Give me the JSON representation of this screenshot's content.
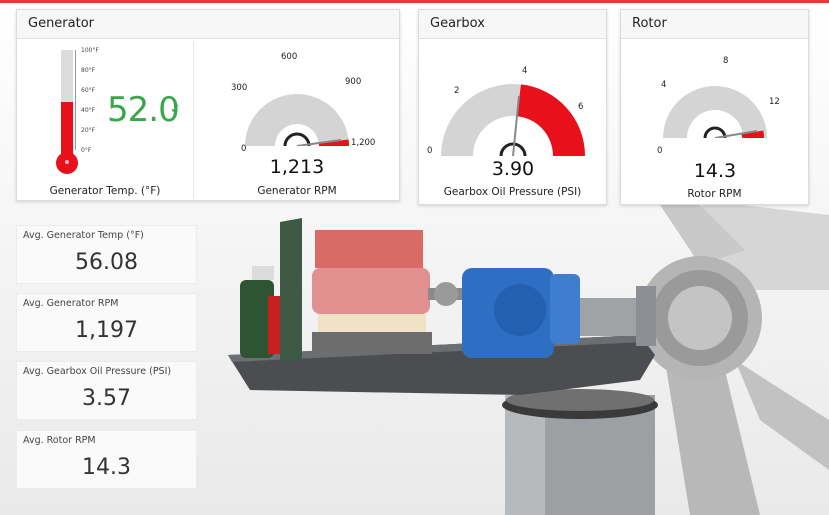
{
  "generator": {
    "title": "Generator",
    "temp_value": "52.0",
    "temp_caption": "Generator Temp.  (°F)",
    "temp_ticks": [
      "100°F",
      "80°F",
      "60°F",
      "40°F",
      "20°F",
      "0°F"
    ],
    "temp_level": 0.52,
    "rpm_value": "1,213",
    "rpm_caption": "Generator RPM",
    "rpm_ticks": [
      "0",
      "300",
      "600",
      "900",
      "1,200"
    ]
  },
  "gearbox": {
    "title": "Gearbox",
    "value": "3.90",
    "caption": "Gearbox Oil Pressure (PSI)",
    "ticks": [
      "0",
      "2",
      "4",
      "6"
    ]
  },
  "rotor": {
    "title": "Rotor",
    "value": "14.3",
    "caption": "Rotor RPM",
    "ticks": [
      "0",
      "4",
      "8",
      "12"
    ]
  },
  "stats": [
    {
      "label": "Avg. Generator Temp (°F)",
      "value": "56.08"
    },
    {
      "label": "Avg. Generator RPM",
      "value": "1,197"
    },
    {
      "label": "Avg.  Gearbox Oil Pressure (PSI)",
      "value": "3.57"
    },
    {
      "label": "Avg.  Rotor RPM",
      "value": "14.3"
    }
  ],
  "colors": {
    "accent_red": "#e8101a",
    "ok_green": "#3aa64a",
    "gauge_gray": "#d4d4d4"
  }
}
